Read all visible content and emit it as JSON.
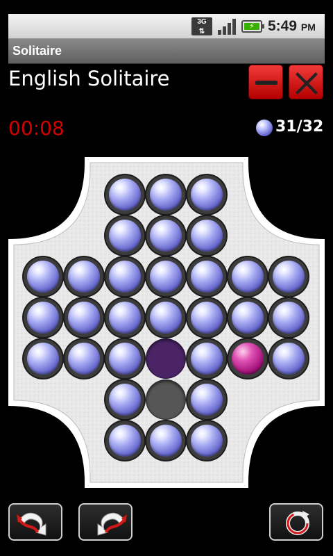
{
  "status_bar": {
    "network": "3G",
    "time": "5:49",
    "ampm": "PM",
    "icons": [
      "3g-data-icon",
      "signal-strength-icon",
      "battery-charging-icon"
    ]
  },
  "app": {
    "title": "Solitaire"
  },
  "game": {
    "name": "English Solitaire",
    "timer": "00:08",
    "pegs_remaining": "31/32",
    "colors": {
      "peg": "#7b7de0",
      "selected_peg": "#c01890",
      "timer": "#d40000",
      "button": "#d80000"
    }
  },
  "board": {
    "layout": "english-cross",
    "rows": [
      "..PPP..",
      "..PPP..",
      "PPPPPPP",
      "PPPPPPP",
      "PPPTPSP",
      "..PHP..",
      "..PPP.."
    ],
    "legend": {
      "P": "peg",
      "T": "target-hole",
      "S": "selected-peg",
      "H": "empty-hole",
      ".": "outside"
    }
  },
  "toolbar": {
    "buttons": [
      "undo-icon",
      "redo-icon",
      "restart-icon"
    ]
  }
}
